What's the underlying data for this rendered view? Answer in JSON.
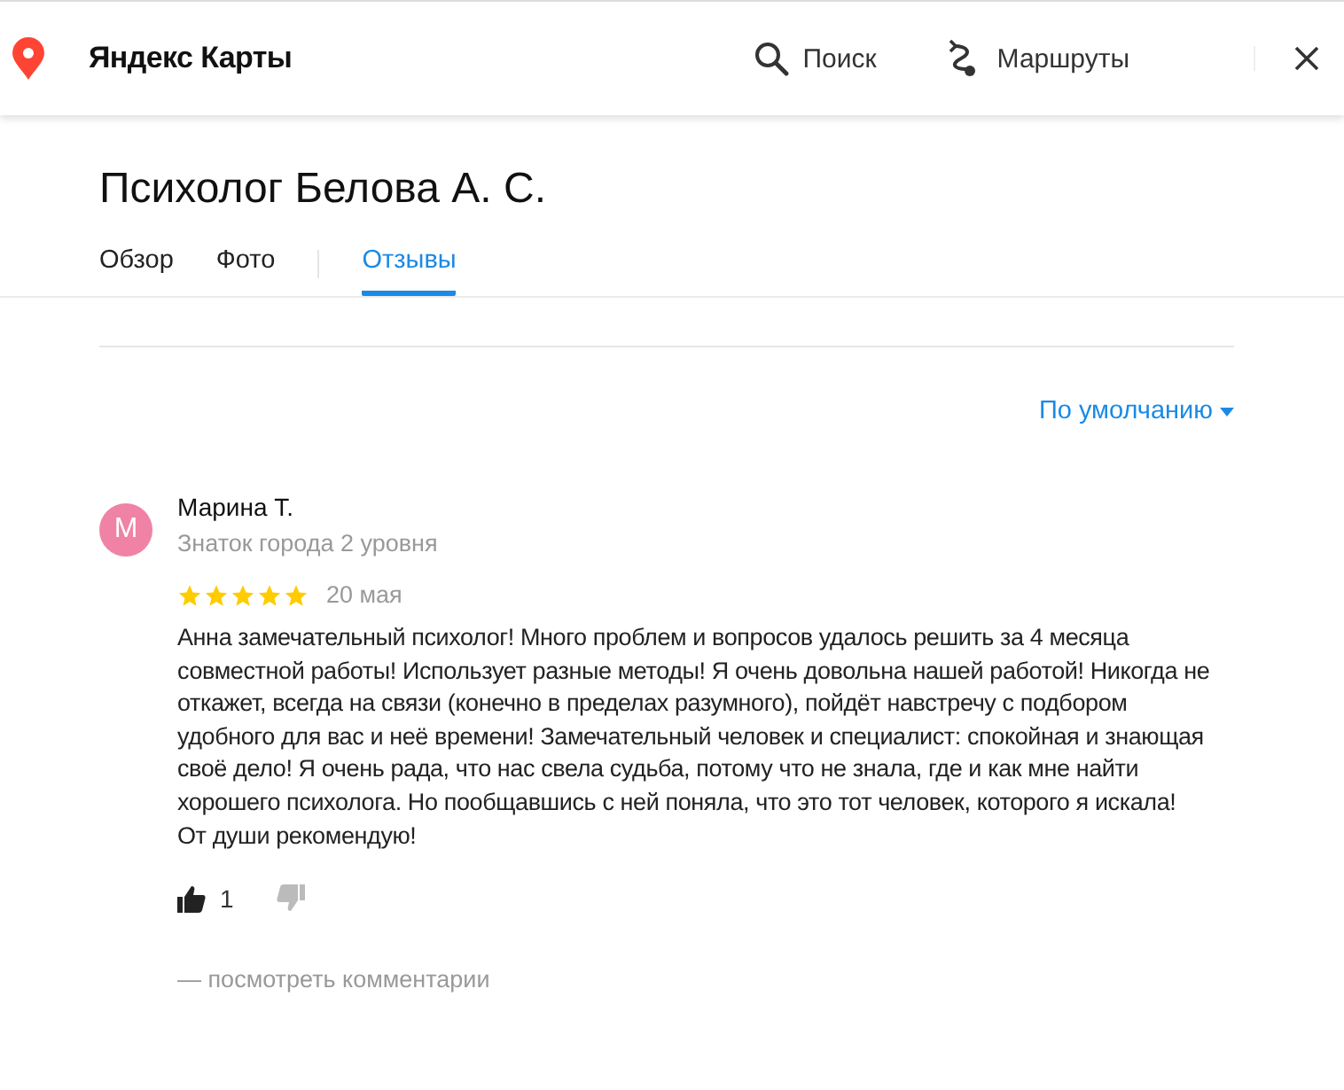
{
  "header": {
    "logo_text": "Яндекс Карты",
    "actions": [
      {
        "kind": "search",
        "label": "Поиск"
      },
      {
        "kind": "routes",
        "label": "Маршруты"
      }
    ]
  },
  "title": "Психолог Белова А. С.",
  "tabs": [
    {
      "label": "Обзор",
      "selected": false
    },
    {
      "label": "Фото",
      "selected": false
    },
    {
      "label": "Отзывы",
      "selected": true
    }
  ],
  "sort": {
    "label": "По умолчанию"
  },
  "review": {
    "avatar_letter": "М",
    "author": "Марина Т.",
    "level": "Знаток города 2 уровня",
    "stars": 5,
    "date": "20 мая",
    "text": "Анна замечательный психолог! Много проблем и вопросов удалось решить за 4 месяца совместной работы! Использует разные методы! Я очень довольна нашей работой! Никогда не откажет, всегда на связи (конечно в пределах разумного), пойдёт навстречу с подбором удобного для вас и неё времени! Замечательный человек и специалист: спокойная и знающая своё дело! Я очень рада, что нас свела судьба, потому что не знала, где и как мне найти хорошего психолога. Но пообщавшись с ней поняла, что это тот человек, которого я искала!\nОт души рекомендую!",
    "likes": "1",
    "comments_link": "— посмотреть комментарии"
  }
}
